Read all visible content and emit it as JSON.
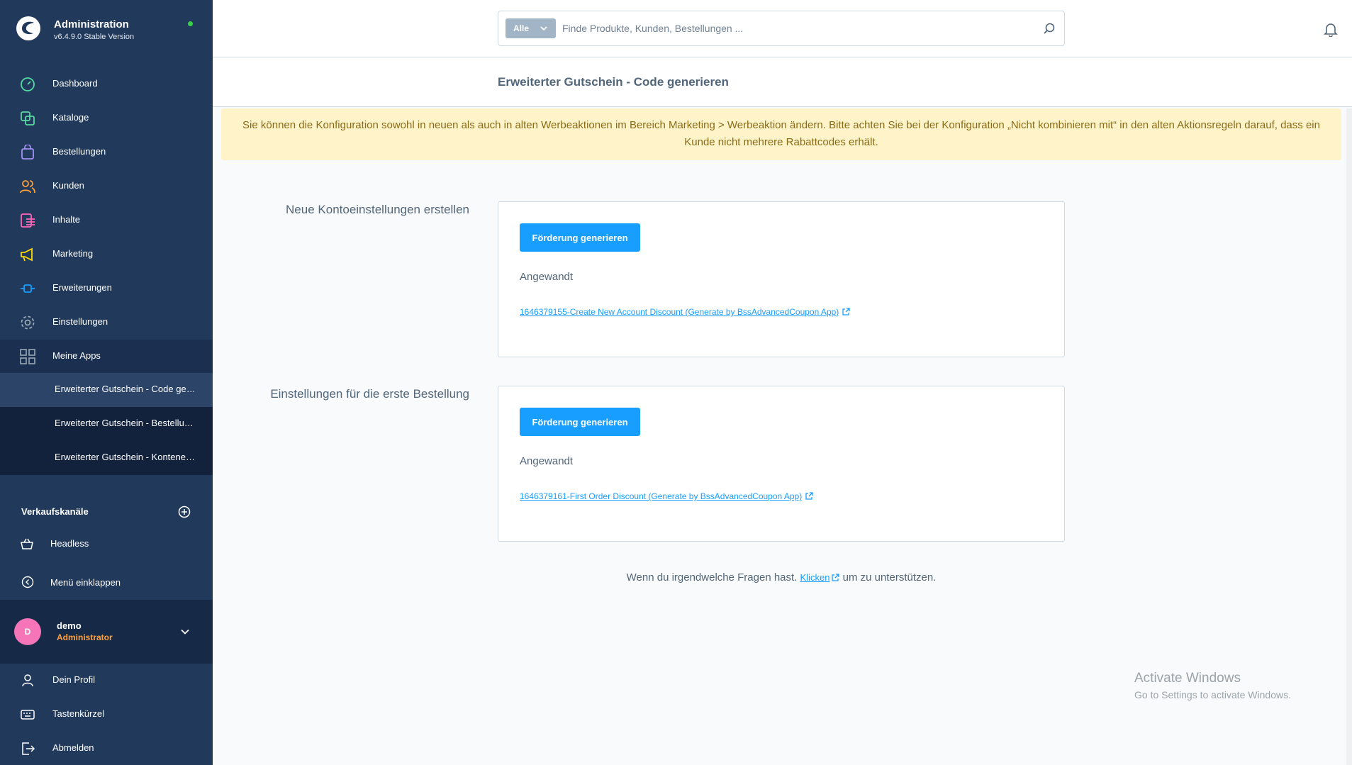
{
  "app": {
    "title": "Administration",
    "version": "v6.4.9.0 Stable Version"
  },
  "nav": [
    {
      "label": "Dashboard",
      "icon": "gauge-icon",
      "color": "#57d9a3"
    },
    {
      "label": "Kataloge",
      "icon": "catalog-icon",
      "color": "#57d9a3"
    },
    {
      "label": "Bestellungen",
      "icon": "shopping-bag-icon",
      "color": "#a092f0"
    },
    {
      "label": "Kunden",
      "icon": "users-icon",
      "color": "#ff9f39"
    },
    {
      "label": "Inhalte",
      "icon": "content-icon",
      "color": "#ff68b4"
    },
    {
      "label": "Marketing",
      "icon": "megaphone-icon",
      "color": "#ffd700"
    },
    {
      "label": "Erweiterungen",
      "icon": "plug-icon",
      "color": "#189eff"
    },
    {
      "label": "Einstellungen",
      "icon": "gear-icon",
      "color": "#9aa8b5"
    },
    {
      "label": "Meine Apps",
      "icon": "apps-grid-icon",
      "color": "#9aa8b5"
    }
  ],
  "sub_nav": [
    {
      "label": "Erweiterter Gutschein - Code generieren"
    },
    {
      "label": "Erweiterter Gutschein - Bestellungen"
    },
    {
      "label": "Erweiterter Gutschein - Kontenerstellung"
    }
  ],
  "sales_channels": {
    "title": "Verkaufskanäle",
    "items": [
      {
        "label": "Headless",
        "icon": "basket-icon"
      }
    ]
  },
  "collapse_label": "Menü einklappen",
  "user": {
    "initial": "D",
    "name": "demo",
    "role": "Administrator"
  },
  "user_menu": [
    {
      "label": "Dein Profil",
      "icon": "user-icon"
    },
    {
      "label": "Tastenkürzel",
      "icon": "keyboard-icon"
    },
    {
      "label": "Abmelden",
      "icon": "logout-icon"
    }
  ],
  "search": {
    "type_label": "Alle",
    "placeholder": "Finde Produkte, Kunden, Bestellungen ..."
  },
  "page": {
    "title": "Erweiterter Gutschein - Code generieren",
    "alert": "Sie können die Konfiguration sowohl in neuen als auch in alten Werbeaktionen im Bereich Marketing > Werbeaktion ändern. Bitte achten Sie bei der Konfiguration „Nicht kombinieren mit“ in den alten Aktionsregeln darauf, dass ein Kunde nicht mehrere Rabattcodes erhält."
  },
  "sections": [
    {
      "label": "Neue Kontoeinstellungen erstellen",
      "button": "Förderung generieren",
      "applied_label": "Angewandt",
      "link": "1646379155-Create New Account Discount (Generate by BssAdvancedCoupon App)"
    },
    {
      "label": "Einstellungen für die erste Bestellung",
      "button": "Förderung generieren",
      "applied_label": "Angewandt",
      "link": "1646379161-First Order Discount (Generate by BssAdvancedCoupon App)"
    }
  ],
  "footer": {
    "before": "Wenn du irgendwelche Fragen hast.",
    "link": "Klicken",
    "after": "um zu unterstützen."
  },
  "watermark": {
    "title": "Activate Windows",
    "subtitle": "Go to Settings to activate Windows."
  },
  "colors": {
    "sidebar": "#213a5c",
    "primary": "#189eff",
    "alert_bg": "#fff3c9",
    "alert_text": "#8a6b16",
    "role": "#ff9f39",
    "avatar": "#f575b8"
  }
}
